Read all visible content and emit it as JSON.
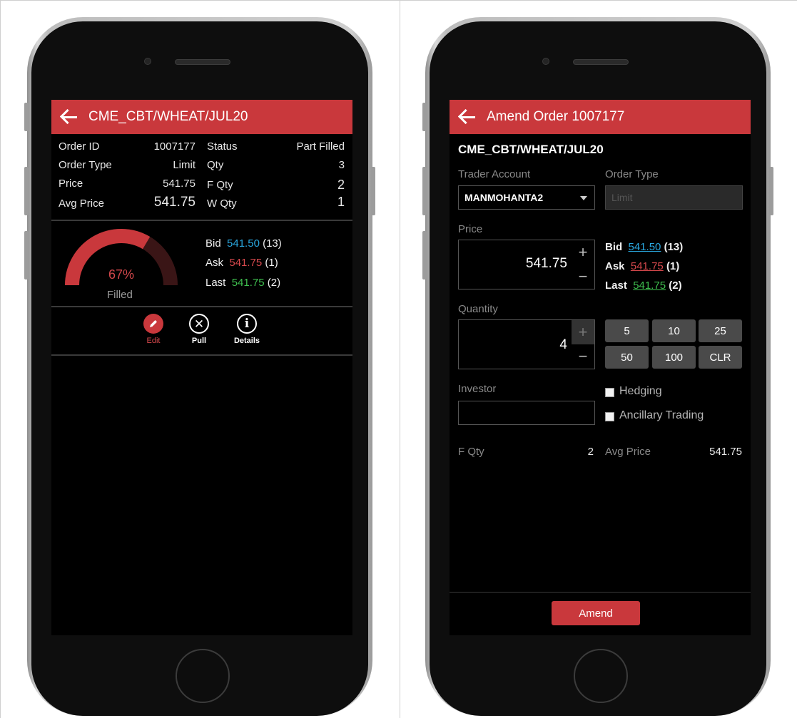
{
  "left": {
    "title": "CME_CBT/WHEAT/JUL20",
    "fields": {
      "order_id_label": "Order ID",
      "order_id": "1007177",
      "status_label": "Status",
      "status": "Part Filled",
      "order_type_label": "Order Type",
      "order_type": "Limit",
      "qty_label": "Qty",
      "qty": "3",
      "price_label": "Price",
      "price": "541.75",
      "f_qty_label": "F Qty",
      "f_qty": "2",
      "avg_price_label": "Avg Price",
      "avg_price": "541.75",
      "w_qty_label": "W Qty",
      "w_qty": "1"
    },
    "gauge": {
      "percent_text": "67%",
      "label": "Filled",
      "fill_fraction": 0.67
    },
    "quotes": {
      "bid_label": "Bid",
      "bid_price": "541.50",
      "bid_qty": "(13)",
      "ask_label": "Ask",
      "ask_price": "541.75",
      "ask_qty": "(1)",
      "last_label": "Last",
      "last_price": "541.75",
      "last_qty": "(2)"
    },
    "actions": {
      "edit": "Edit",
      "pull": "Pull",
      "details": "Details"
    }
  },
  "right": {
    "title": "Amend Order 1007177",
    "instrument": "CME_CBT/WHEAT/JUL20",
    "trader_account_label": "Trader Account",
    "trader_account": "MANMOHANTA2",
    "order_type_label": "Order Type",
    "order_type_placeholder": "Limit",
    "price_label": "Price",
    "price_value": "541.75",
    "quotes": {
      "bid_label": "Bid",
      "bid_price": "541.50",
      "bid_qty": "(13)",
      "ask_label": "Ask",
      "ask_price": "541.75",
      "ask_qty": "(1)",
      "last_label": "Last",
      "last_price": "541.75",
      "last_qty": "(2)"
    },
    "quantity_label": "Quantity",
    "quantity_value": "4",
    "qty_buttons": [
      "5",
      "10",
      "25",
      "50",
      "100",
      "CLR"
    ],
    "investor_label": "Investor",
    "hedging_label": "Hedging",
    "ancillary_label": "Ancillary Trading",
    "f_qty_label": "F Qty",
    "f_qty": "2",
    "avg_price_label": "Avg Price",
    "avg_price": "541.75",
    "amend_label": "Amend"
  },
  "colors": {
    "accent": "#c9383c",
    "bid": "#2aa8e0",
    "ask": "#d6484c",
    "last": "#3fbf4f"
  }
}
